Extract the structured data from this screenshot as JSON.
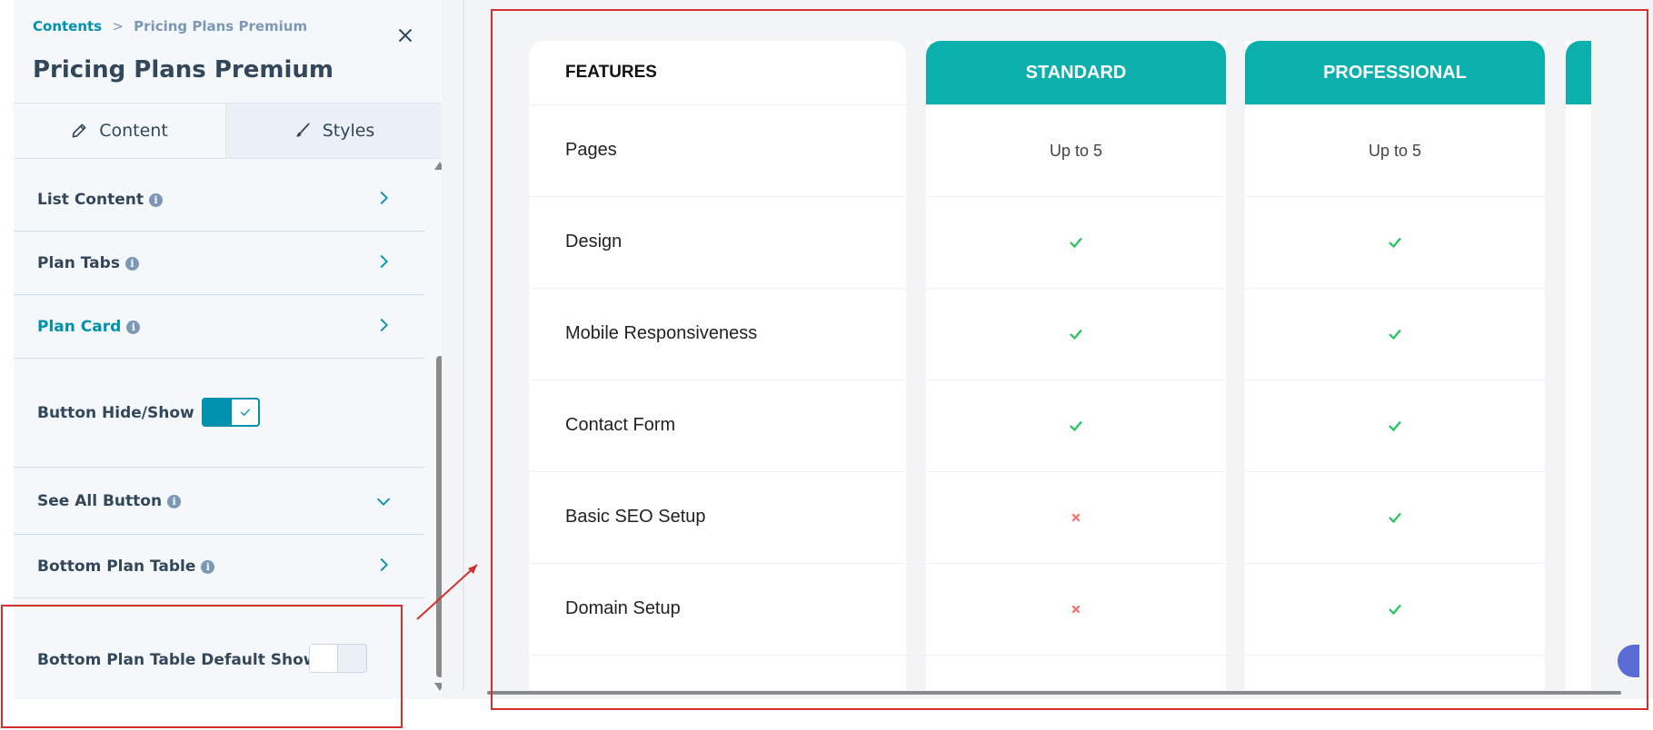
{
  "panel": {
    "breadcrumb": {
      "parent": "Contents",
      "separator": ">",
      "current": "Pricing Plans Premium"
    },
    "title": "Pricing Plans Premium",
    "tabs": [
      {
        "label": "Content",
        "icon": "pencil-icon"
      },
      {
        "label": "Styles",
        "icon": "brush-icon"
      }
    ],
    "settings": [
      {
        "label": "List Content",
        "has_info": true,
        "control": "chevron-right"
      },
      {
        "label": "Plan Tabs",
        "has_info": true,
        "control": "chevron-right"
      },
      {
        "label": "Plan Card",
        "has_info": true,
        "control": "chevron-right",
        "active": true
      },
      {
        "label": "Button Hide/Show",
        "control": "toggle",
        "value": true
      },
      {
        "label": "See All Button",
        "has_info": true,
        "control": "chevron-down"
      },
      {
        "label": "Bottom Plan Table",
        "has_info": true,
        "control": "chevron-right"
      },
      {
        "label": "Bottom Plan Table Default Show",
        "control": "toggle",
        "value": false
      }
    ],
    "info_glyph": "i"
  },
  "table": {
    "features_header": "FEATURES",
    "features": [
      "Pages",
      "Design",
      "Mobile Responsiveness",
      "Contact Form",
      "Basic SEO Setup",
      "Domain Setup"
    ],
    "plans": [
      {
        "name": "STANDARD",
        "cells": [
          "Up to 5",
          "check",
          "check",
          "check",
          "cross",
          "cross"
        ]
      },
      {
        "name": "PROFESSIONAL",
        "cells": [
          "Up to 5",
          "check",
          "check",
          "check",
          "check",
          "check"
        ]
      }
    ]
  },
  "colors": {
    "accent": "#0091ae",
    "plan_header": "#0bb0ad",
    "check": "#22c55e",
    "cross": "#f87171",
    "highlight": "#d32f2f"
  }
}
